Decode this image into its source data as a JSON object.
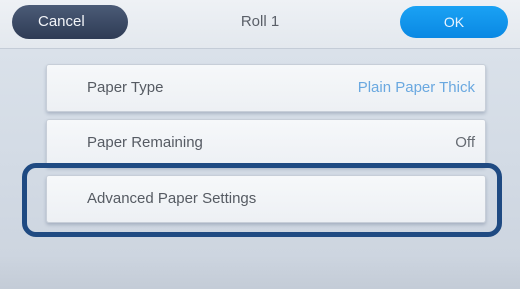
{
  "header": {
    "cancel_label": "Cancel",
    "title": "Roll 1",
    "ok_label": "OK"
  },
  "rows": [
    {
      "label": "Paper Type",
      "value": "Plain Paper Thick"
    },
    {
      "label": "Paper Remaining",
      "value": "Off"
    },
    {
      "label": "Advanced Paper Settings"
    }
  ],
  "colors": {
    "cancel_button": "#2e3b55",
    "ok_button": "#0a88e3",
    "focus_ring": "#1f4a82",
    "value_accent": "#6aa8e0"
  }
}
